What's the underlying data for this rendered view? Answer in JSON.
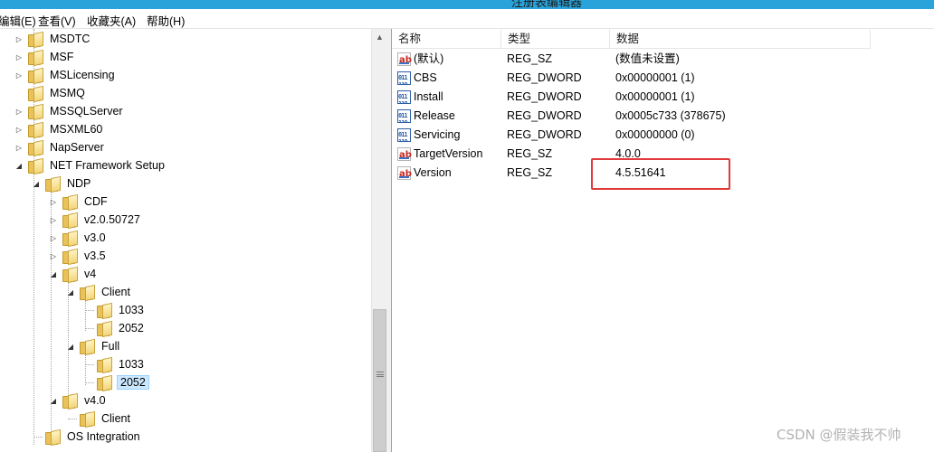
{
  "titlebar": {
    "title": "注册表编辑器"
  },
  "menu": [
    {
      "label": "编辑(E)"
    },
    {
      "label": "查看(V)"
    },
    {
      "label": "收藏夹(A)"
    },
    {
      "label": "帮助(H)"
    }
  ],
  "tree": [
    {
      "label": "MSDTC",
      "expander": "collapsed"
    },
    {
      "label": "MSF",
      "expander": "collapsed"
    },
    {
      "label": "MSLicensing",
      "expander": "collapsed"
    },
    {
      "label": "MSMQ",
      "expander": "none"
    },
    {
      "label": "MSSQLServer",
      "expander": "collapsed"
    },
    {
      "label": "MSXML60",
      "expander": "collapsed"
    },
    {
      "label": "NapServer",
      "expander": "collapsed"
    },
    {
      "label": "NET Framework Setup",
      "expander": "expanded"
    },
    {
      "label": "NDP",
      "expander": "expanded"
    },
    {
      "label": "CDF",
      "expander": "collapsed"
    },
    {
      "label": "v2.0.50727",
      "expander": "collapsed"
    },
    {
      "label": "v3.0",
      "expander": "collapsed"
    },
    {
      "label": "v3.5",
      "expander": "collapsed"
    },
    {
      "label": "v4",
      "expander": "expanded"
    },
    {
      "label": "Client",
      "expander": "expanded"
    },
    {
      "label": "1033",
      "expander": "none"
    },
    {
      "label": "2052",
      "expander": "none"
    },
    {
      "label": "Full",
      "expander": "expanded"
    },
    {
      "label": "1033",
      "expander": "none"
    },
    {
      "label": "2052",
      "expander": "none",
      "selected": true
    },
    {
      "label": "v4.0",
      "expander": "expanded"
    },
    {
      "label": "Client",
      "expander": "none"
    },
    {
      "label": "OS Integration",
      "expander": "none"
    }
  ],
  "list": {
    "headers": {
      "name": "名称",
      "type": "类型",
      "data": "数据"
    },
    "rows": [
      {
        "icon": "string-value-icon",
        "name": "(默认)",
        "type": "REG_SZ",
        "data": "(数值未设置)"
      },
      {
        "icon": "dword-value-icon",
        "name": "CBS",
        "type": "REG_DWORD",
        "data": "0x00000001 (1)"
      },
      {
        "icon": "dword-value-icon",
        "name": "Install",
        "type": "REG_DWORD",
        "data": "0x00000001 (1)"
      },
      {
        "icon": "dword-value-icon",
        "name": "Release",
        "type": "REG_DWORD",
        "data": "0x0005c733 (378675)"
      },
      {
        "icon": "dword-value-icon",
        "name": "Servicing",
        "type": "REG_DWORD",
        "data": "0x00000000 (0)"
      },
      {
        "icon": "string-value-icon",
        "name": "TargetVersion",
        "type": "REG_SZ",
        "data": "4.0.0"
      },
      {
        "icon": "string-value-icon",
        "name": "Version",
        "type": "REG_SZ",
        "data": "4.5.51641"
      }
    ]
  },
  "watermark": "CSDN @假装我不帅",
  "colors": {
    "titlebar": "#29a3da",
    "highlight": "#e03a3a",
    "selection": "#cce8ff"
  }
}
